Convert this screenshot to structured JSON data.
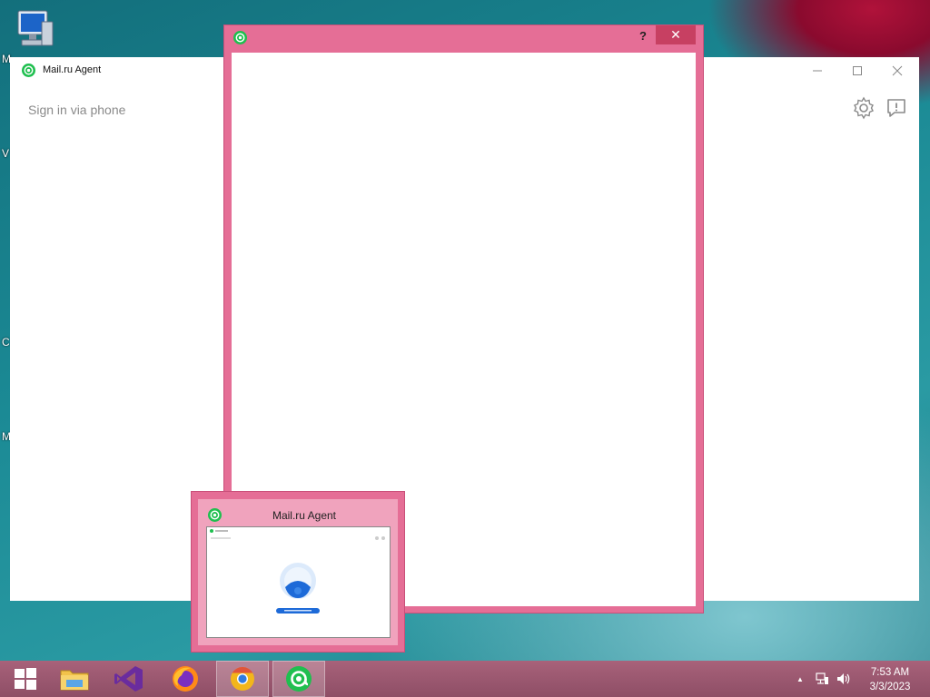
{
  "desktop": {
    "icons": [
      {
        "name": "computer-icon"
      }
    ],
    "partial_labels": [
      "M",
      "V",
      "C",
      "M"
    ]
  },
  "agent_window": {
    "title": "Mail.ru Agent",
    "sign_in_link": "Sign in via phone",
    "controls": [
      "minimize",
      "maximize",
      "close"
    ]
  },
  "dialog": {
    "help_label": "?",
    "close_label": "✕"
  },
  "thumbnail": {
    "title": "Mail.ru Agent"
  },
  "taskbar": {
    "apps": [
      "start",
      "file-explorer",
      "visual-studio",
      "firefox",
      "chrome-canary",
      "mail-ru-agent"
    ],
    "clock_time": "7:53 AM",
    "clock_date": "3/3/2023",
    "tray_arrow": "▲"
  },
  "colors": {
    "accent_pink": "#e56e96",
    "agent_green": "#1fbf4f",
    "close_red": "#c74062"
  }
}
